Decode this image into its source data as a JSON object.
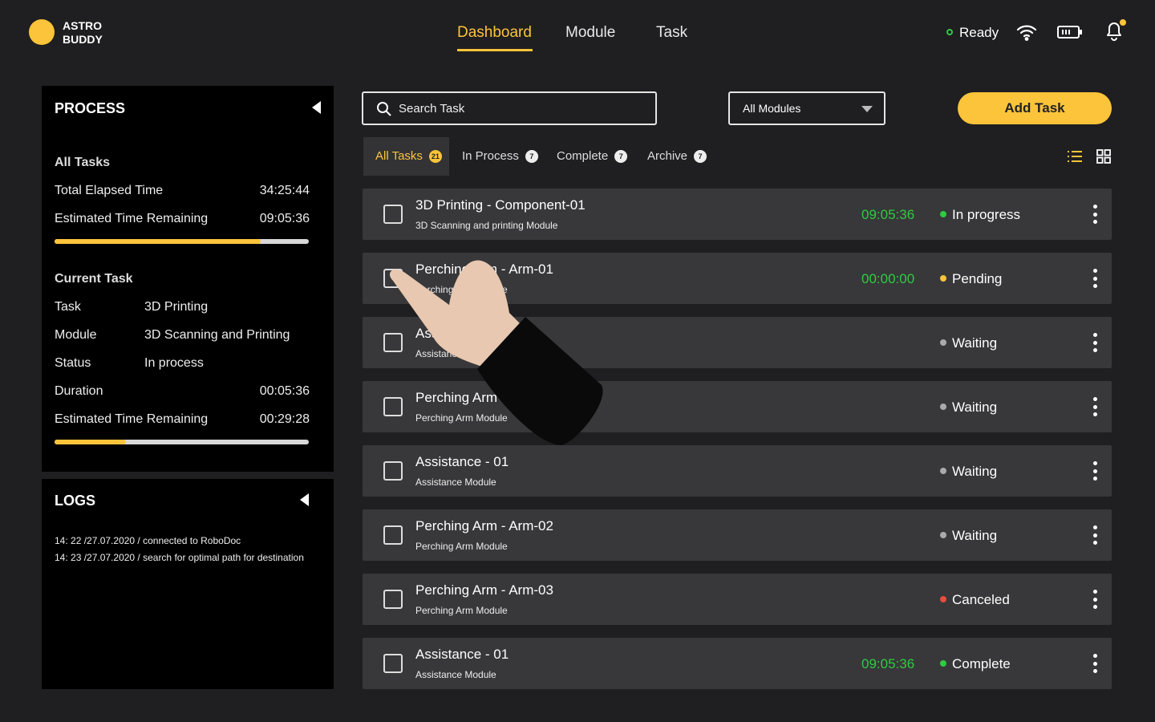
{
  "brand": {
    "line1": "ASTRO",
    "line2": "BUDDY"
  },
  "nav": [
    {
      "label": "Dashboard",
      "active": true
    },
    {
      "label": "Module"
    },
    {
      "label": "Task"
    }
  ],
  "status": {
    "label": "Ready",
    "color": "#2ecc40"
  },
  "icons": [
    "wifi-icon",
    "battery-icon",
    "bell-icon"
  ],
  "process": {
    "title": "PROCESS",
    "all_tasks": {
      "heading": "All Tasks",
      "total_label": "Total Elapsed Time",
      "total": "34:25:44",
      "remaining_label": "Estimated Time Remaining",
      "remaining": "09:05:36",
      "progress": 0.81
    },
    "current": {
      "heading": "Current Task",
      "task_label": "Task",
      "task": "3D Printing",
      "module_label": "Module",
      "module": "3D Scanning and Printing",
      "status_label": "Status",
      "status": "In process",
      "duration_label": "Duration",
      "duration": "00:05:36",
      "remaining_label": "Estimated Time Remaining",
      "remaining": "00:29:28",
      "progress": 0.28
    }
  },
  "logs": {
    "title": "LOGS",
    "entries": [
      "14: 22 /27.07.2020 / connected to RoboDoc",
      "14: 23 /27.07.2020 / search for optimal path for destination"
    ]
  },
  "search": {
    "placeholder": "Search Task"
  },
  "module_filter": {
    "value": "All Modules"
  },
  "add_task": "Add Task",
  "tabs": [
    {
      "label": "All Tasks",
      "count": "21",
      "active": true
    },
    {
      "label": "In Process",
      "count": "7"
    },
    {
      "label": "Complete",
      "count": "7"
    },
    {
      "label": "Archive",
      "count": "7"
    }
  ],
  "accent": "#fcc43a",
  "tasks": [
    {
      "name": "3D Printing - Component-01",
      "module": "3D Scanning and printing Module",
      "time": "09:05:36",
      "status": "In progress",
      "color": "#2ecc40"
    },
    {
      "name": "Perching Arm - Arm-01",
      "module": "Perching Arm Module",
      "time": "00:00:00",
      "status": "Pending",
      "color": "#fcc43a"
    },
    {
      "name": "Assistance - 01",
      "module": "Assistance Module",
      "time": "",
      "status": "Waiting",
      "color": "#aaaaaa"
    },
    {
      "name": "Perching Arm - Arm-01",
      "module": "Perching Arm Module",
      "time": "",
      "status": "Waiting",
      "color": "#aaaaaa"
    },
    {
      "name": "Assistance - 01",
      "module": "Assistance Module",
      "time": "",
      "status": "Waiting",
      "color": "#aaaaaa"
    },
    {
      "name": "Perching Arm - Arm-02",
      "module": "Perching Arm Module",
      "time": "",
      "status": "Waiting",
      "color": "#aaaaaa"
    },
    {
      "name": "Perching Arm - Arm-03",
      "module": "Perching Arm Module",
      "time": "",
      "status": "Canceled",
      "color": "#e74c3c"
    },
    {
      "name": "Assistance - 01",
      "module": "Assistance Module",
      "time": "09:05:36",
      "status": "Complete",
      "color": "#2ecc40"
    }
  ]
}
